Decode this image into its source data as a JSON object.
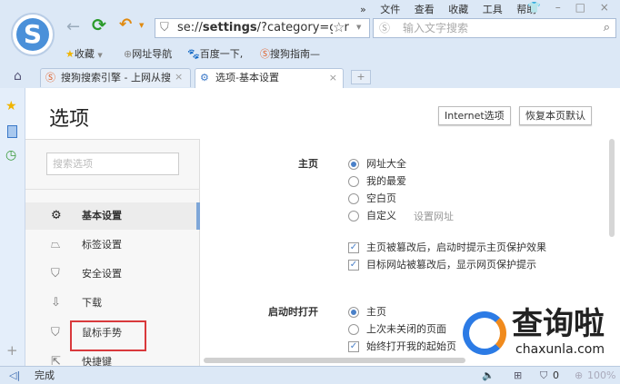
{
  "menu": [
    "»",
    "文件",
    "查看",
    "收藏",
    "工具",
    "帮助"
  ],
  "window_controls": {
    "skin": "👕",
    "minimize": "–",
    "maximize": "□",
    "close": "×"
  },
  "address": {
    "prefix": "se://",
    "bold": "settings",
    "suffix": "/?category=ger"
  },
  "search": {
    "placeholder": "输入文字搜索"
  },
  "bookmarks": [
    "收藏",
    "网址导航",
    "百度一下,",
    "搜狗指南—"
  ],
  "tabs": [
    {
      "label": "搜狗搜索引擎 - 上网从搜",
      "active": false
    },
    {
      "label": "选项-基本设置",
      "active": true
    }
  ],
  "page": {
    "title": "选项",
    "internet_btn": "Internet选项",
    "restore_btn": "恢复本页默认",
    "search_placeholder": "搜索选项"
  },
  "nav": [
    {
      "label": "基本设置",
      "icon": "gear-icon",
      "active": true
    },
    {
      "label": "标签设置",
      "icon": "tab-icon"
    },
    {
      "label": "安全设置",
      "icon": "shield-check-icon"
    },
    {
      "label": "下载",
      "icon": "download-icon"
    },
    {
      "label": "鼠标手势",
      "icon": "mouse-icon",
      "highlighted": true
    },
    {
      "label": "快捷键",
      "icon": "shortcut-icon"
    }
  ],
  "homepage": {
    "label": "主页",
    "options": [
      "网址大全",
      "我的最爱",
      "空白页",
      "自定义"
    ],
    "selected": 0,
    "set_url": "设置网址",
    "checks": [
      "主页被篡改后，启动时提示主页保护效果",
      "目标网站被篡改后，显示网页保护提示"
    ]
  },
  "startup": {
    "label": "启动时打开",
    "options": [
      "主页",
      "上次未关闭的页面"
    ],
    "selected": 0,
    "check": "始终打开我的起始页"
  },
  "status": {
    "text": "完成",
    "count": "0",
    "zoom": "100%"
  },
  "watermark": {
    "text": "查询啦",
    "url": "chaxunla.com"
  },
  "colors": {
    "accent": "#4a80c8",
    "chrome": "#dce8f6",
    "highlight_border": "#d9393c"
  }
}
